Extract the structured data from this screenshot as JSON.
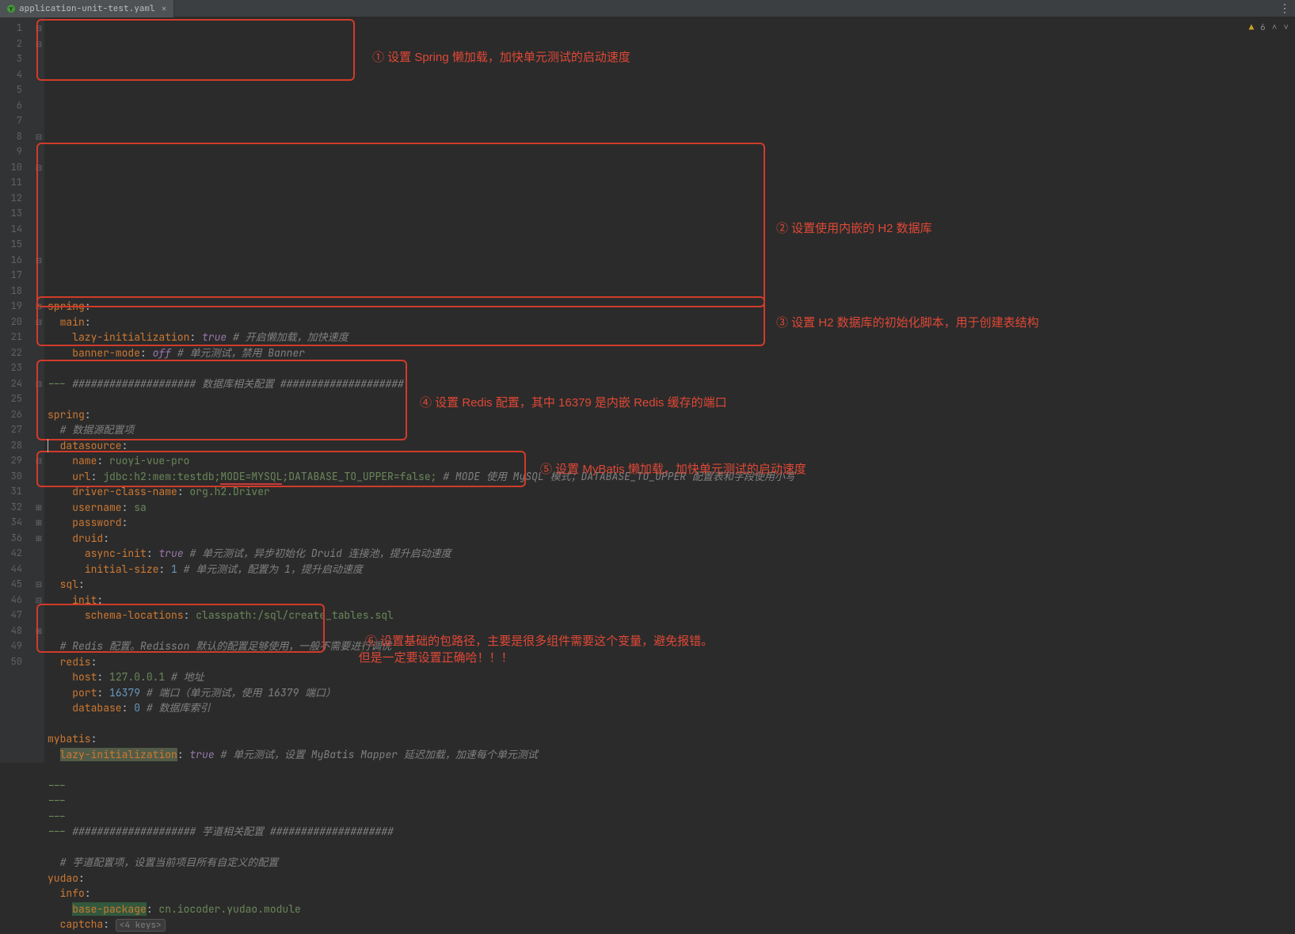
{
  "tab": {
    "filename": "application-unit-test.yaml"
  },
  "status": {
    "warnings": "6"
  },
  "gutter_lines": [
    "1",
    "2",
    "3",
    "4",
    "5",
    "6",
    "7",
    "8",
    "9",
    "10",
    "11",
    "12",
    "13",
    "14",
    "15",
    "16",
    "17",
    "18",
    "19",
    "20",
    "21",
    "22",
    "23",
    "24",
    "25",
    "26",
    "27",
    "28",
    "29",
    "30",
    "31",
    "32",
    "34",
    "36",
    "42",
    "44",
    "45",
    "46",
    "47",
    "48",
    "49",
    "50"
  ],
  "fold_marks": {
    "0": "⊟",
    "1": "⊟",
    "7": "⊟",
    "9": "⊟",
    "15": "⊟",
    "18": "⊟",
    "19": "⊟",
    "23": "⊟",
    "28": "⊟",
    "31": "⊞",
    "32": "⊞",
    "33": "⊞",
    "36": "⊟",
    "37": "⊟",
    "39": "⊞"
  },
  "code_lines": [
    [
      [
        "k",
        "spring"
      ],
      [
        "",
        ":"
      ]
    ],
    [
      [
        "",
        "  "
      ],
      [
        "k",
        "main"
      ],
      [
        "",
        ":"
      ]
    ],
    [
      [
        "",
        "    "
      ],
      [
        "k",
        "lazy-initialization"
      ],
      [
        "",
        ": "
      ],
      [
        "b",
        "true"
      ],
      [
        "",
        " "
      ],
      [
        "c",
        "# 开启懒加载，加快速度"
      ]
    ],
    [
      [
        "",
        "    "
      ],
      [
        "k",
        "banner-mode"
      ],
      [
        "",
        ": "
      ],
      [
        "b",
        "off"
      ],
      [
        "",
        " "
      ],
      [
        "c",
        "# 单元测试，禁用 Banner"
      ]
    ],
    [
      [
        "",
        ""
      ]
    ],
    [
      [
        "s",
        "--- "
      ],
      [
        "c",
        "#################### 数据库相关配置 ####################"
      ]
    ],
    [
      [
        "",
        ""
      ]
    ],
    [
      [
        "k",
        "spring"
      ],
      [
        "",
        ":"
      ]
    ],
    [
      [
        "",
        "  "
      ],
      [
        "c",
        "# 数据源配置项"
      ]
    ],
    [
      [
        "",
        "  "
      ],
      [
        "k",
        "datasource"
      ],
      [
        "",
        ":"
      ]
    ],
    [
      [
        "",
        "    "
      ],
      [
        "k",
        "name"
      ],
      [
        "",
        ": "
      ],
      [
        "s",
        "ruoyi-vue-pro"
      ]
    ],
    [
      [
        "",
        "    "
      ],
      [
        "k",
        "url"
      ],
      [
        "",
        ": "
      ],
      [
        "s",
        "jdbc:h2:mem:testdb;"
      ],
      [
        "s underline",
        "MODE=MYSQL"
      ],
      [
        "s",
        ";DATABASE_TO_UPPER=false;"
      ],
      [
        "",
        " "
      ],
      [
        "c",
        "# MODE 使用 MySQL 模式；DATABASE_TO_UPPER 配置表和字段使用小写"
      ]
    ],
    [
      [
        "",
        "    "
      ],
      [
        "k",
        "driver-class-name"
      ],
      [
        "",
        ": "
      ],
      [
        "s",
        "org.h2.Driver"
      ]
    ],
    [
      [
        "",
        "    "
      ],
      [
        "k",
        "username"
      ],
      [
        "",
        ": "
      ],
      [
        "s",
        "sa"
      ]
    ],
    [
      [
        "",
        "    "
      ],
      [
        "k",
        "password"
      ],
      [
        "",
        ":"
      ]
    ],
    [
      [
        "",
        "    "
      ],
      [
        "k",
        "druid"
      ],
      [
        "",
        ":"
      ]
    ],
    [
      [
        "",
        "      "
      ],
      [
        "k",
        "async-init"
      ],
      [
        "",
        ": "
      ],
      [
        "b",
        "true"
      ],
      [
        "",
        " "
      ],
      [
        "c",
        "# 单元测试，异步初始化 Druid 连接池，提升启动速度"
      ]
    ],
    [
      [
        "",
        "      "
      ],
      [
        "k",
        "initial-size"
      ],
      [
        "",
        ": "
      ],
      [
        "n",
        "1"
      ],
      [
        "",
        " "
      ],
      [
        "c",
        "# 单元测试，配置为 1，提升启动速度"
      ]
    ],
    [
      [
        "",
        "  "
      ],
      [
        "k",
        "sql"
      ],
      [
        "",
        ":"
      ]
    ],
    [
      [
        "",
        "    "
      ],
      [
        "k",
        "init"
      ],
      [
        "",
        ":"
      ]
    ],
    [
      [
        "",
        "      "
      ],
      [
        "k",
        "schema-locations"
      ],
      [
        "",
        ": "
      ],
      [
        "s",
        "classpath:/sql/create_tables.sql"
      ]
    ],
    [
      [
        "",
        ""
      ]
    ],
    [
      [
        "",
        "  "
      ],
      [
        "c",
        "# Redis 配置。Redisson 默认的配置足够使用，一般不需要进行调优"
      ]
    ],
    [
      [
        "",
        "  "
      ],
      [
        "k",
        "redis"
      ],
      [
        "",
        ":"
      ]
    ],
    [
      [
        "",
        "    "
      ],
      [
        "k",
        "host"
      ],
      [
        "",
        ": "
      ],
      [
        "s",
        "127.0.0.1"
      ],
      [
        "",
        " "
      ],
      [
        "c",
        "# 地址"
      ]
    ],
    [
      [
        "",
        "    "
      ],
      [
        "k",
        "port"
      ],
      [
        "",
        ": "
      ],
      [
        "n",
        "16379"
      ],
      [
        "",
        " "
      ],
      [
        "c",
        "# 端口（单元测试，使用 16379 端口）"
      ]
    ],
    [
      [
        "",
        "    "
      ],
      [
        "k",
        "database"
      ],
      [
        "",
        ": "
      ],
      [
        "n",
        "0"
      ],
      [
        "",
        " "
      ],
      [
        "c",
        "# 数据库索引"
      ]
    ],
    [
      [
        "",
        ""
      ]
    ],
    [
      [
        "k",
        "mybatis"
      ],
      [
        "",
        ":"
      ]
    ],
    [
      [
        "",
        "  "
      ],
      [
        "k hl",
        "lazy-initialization"
      ],
      [
        "",
        ": "
      ],
      [
        "b",
        "true"
      ],
      [
        "",
        " "
      ],
      [
        "c",
        "# 单元测试，设置 MyBatis Mapper 延迟加载，加速每个单元测试"
      ]
    ],
    [
      [
        "",
        ""
      ]
    ],
    [
      [
        "s",
        "---"
      ]
    ],
    [
      [
        "s",
        "---"
      ]
    ],
    [
      [
        "s",
        "---"
      ]
    ],
    [
      [
        "s",
        "--- "
      ],
      [
        "c",
        "#################### 芋道相关配置 ####################"
      ]
    ],
    [
      [
        "",
        ""
      ]
    ],
    [
      [
        "",
        "  "
      ],
      [
        "c",
        "# 芋道配置项，设置当前项目所有自定义的配置"
      ]
    ],
    [
      [
        "k",
        "yudao"
      ],
      [
        "",
        ":"
      ]
    ],
    [
      [
        "",
        "  "
      ],
      [
        "k",
        "info"
      ],
      [
        "",
        ":"
      ]
    ],
    [
      [
        "",
        "    "
      ],
      [
        "k hl2",
        "base-package"
      ],
      [
        "",
        ": "
      ],
      [
        "s",
        "cn.iocoder.yudao.module"
      ]
    ],
    [
      [
        "",
        "  "
      ],
      [
        "k",
        "captcha"
      ],
      [
        "",
        ": "
      ],
      [
        "fold",
        "<4 keys>"
      ]
    ]
  ],
  "annotations": {
    "a1": "① 设置 Spring 懒加载，加快单元测试的启动速度",
    "a2": "② 设置使用内嵌的 H2 数据库",
    "a3": "③ 设置 H2 数据库的初始化脚本，用于创建表结构",
    "a4": "④ 设置 Redis 配置，其中 16379 是内嵌 Redis 缓存的端口",
    "a5": "⑤ 设置 MyBatis 懒加载，加快单元测试的启动速度",
    "a6_l1": "⑥ 设置基础的包路径，主要是很多组件需要这个变量，避免报错。",
    "a6_l2": "    但是一定要设置正确哈！！！"
  }
}
